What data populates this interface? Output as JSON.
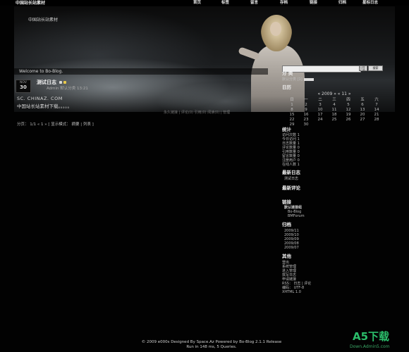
{
  "site": {
    "title": "中国站长站素材",
    "slogan": "中国站长站素材",
    "welcome": "Welcome to Bo-Blog."
  },
  "nav": [
    "首页",
    "标签",
    "留言",
    "存档",
    "链接",
    "归档",
    "星标日志"
  ],
  "post": {
    "month": "NOV",
    "day": "30",
    "title": "测试日志",
    "meta": "Admin  默认分类   13:21",
    "url": "SC. CHINAZ. COM",
    "body": "中国站长站素材下载。。。。。",
    "footer": "永久链接 | 评论(0) 引用(0) 阅读(0) | 管理"
  },
  "pager": "分页：  1/1  «  1  »  [ 显示模式：  摘要  |  列表 ]",
  "search": {
    "select_label": "日志标题",
    "button_label": "搜索"
  },
  "sidebar": {
    "categories": {
      "title": "分 类",
      "item": "默认分类 [1]"
    },
    "calendar": {
      "title": "日历",
      "header": "«  2009 »  «  11  »",
      "dow": [
        "日",
        "一",
        "二",
        "三",
        "四",
        "五",
        "六"
      ],
      "weeks": [
        [
          "1",
          "2",
          "3",
          "4",
          "5",
          "6",
          "7"
        ],
        [
          "8",
          "9",
          "10",
          "11",
          "12",
          "13",
          "14"
        ],
        [
          "15",
          "16",
          "17",
          "18",
          "19",
          "20",
          "21"
        ],
        [
          "22",
          "23",
          "24",
          "25",
          "26",
          "27",
          "28"
        ],
        [
          "29",
          "30",
          "",
          "",
          "",
          "",
          ""
        ]
      ]
    },
    "stats": {
      "title": "统计",
      "rows": [
        "访问次数  1",
        "今日访问  1",
        "日志数量  1",
        "评论数量  0",
        "引用数量  0",
        "留言数量  0",
        "注册用户  0",
        "在线人数  1"
      ]
    },
    "latest_posts": {
      "title": "最新日志",
      "items": [
        "测试日志"
      ]
    },
    "latest_comments": {
      "title": "最新评论"
    },
    "links": {
      "title": "链接",
      "group": "默认链接组",
      "items": [
        "Bo-Blog",
        "BMForum"
      ]
    },
    "archives": {
      "title": "归档",
      "items": [
        "2009/11",
        "2009/10",
        "2009/09",
        "2009/08",
        "2009/07"
      ]
    },
    "misc": {
      "title": "其他",
      "items": [
        "登出",
        "系统管理",
        "进入管理",
        "撰写日志",
        "申请链接",
        "RSS：  日志 | 评论",
        "编码：  UTF-8",
        "XHTML 1.0"
      ]
    }
  },
  "footer": {
    "line1": "© 2009 e000s Designed By Space.Az Powered by Bo-Blog 2.1.1 Release",
    "line2": "Run in 148 ms, 5 Queries."
  },
  "watermark": {
    "big": "A5下载",
    "small": "Down.Admin5.com"
  }
}
